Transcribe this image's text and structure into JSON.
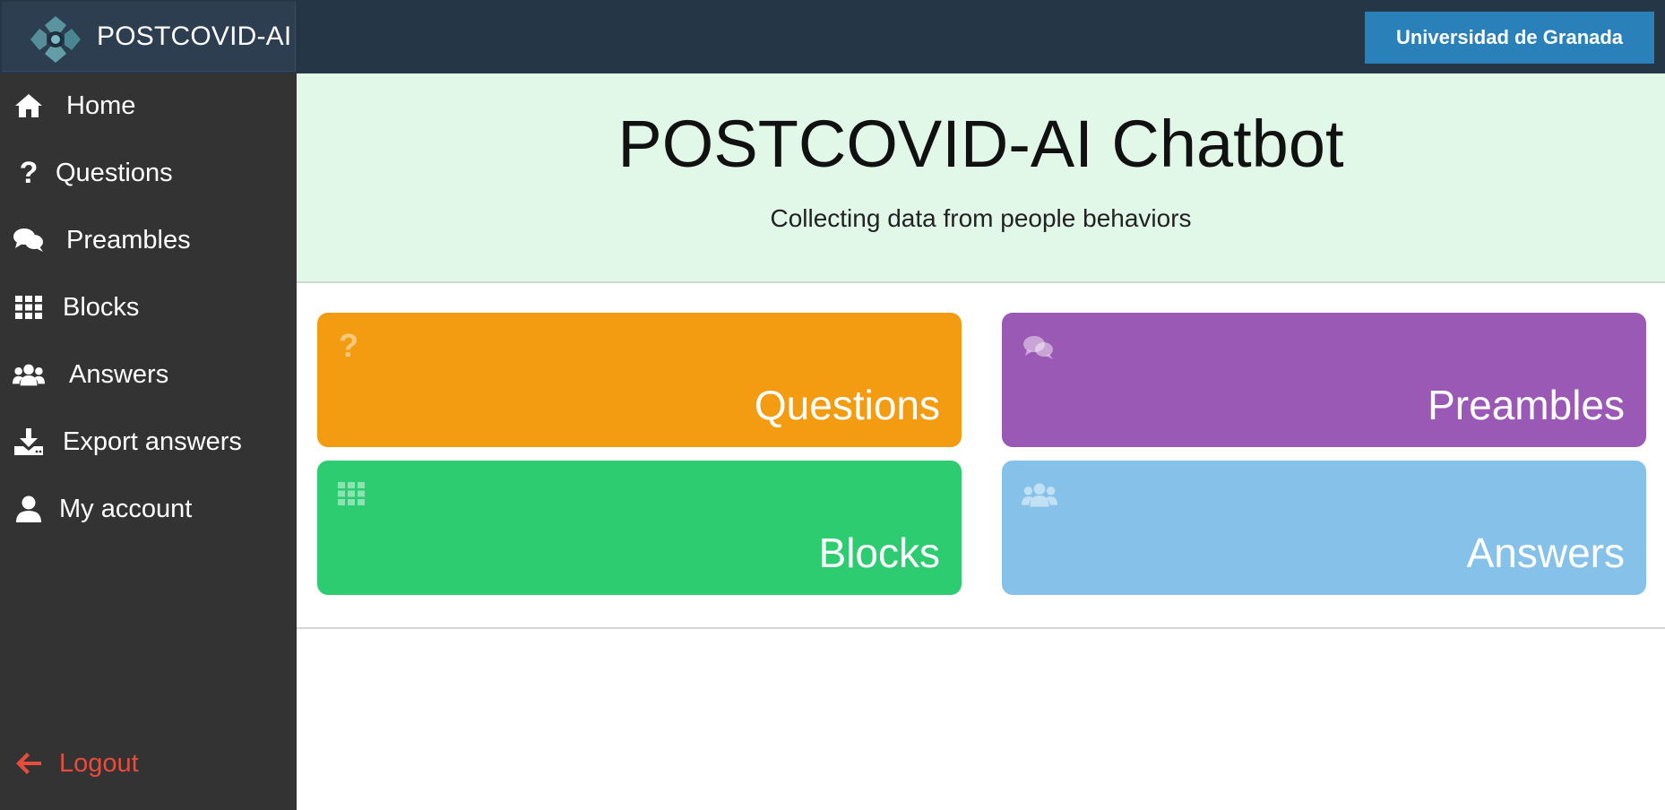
{
  "app": {
    "brand_name": "POSTCOVID-AI",
    "university_button": "Universidad de Granada"
  },
  "sidebar": {
    "items": [
      {
        "label": "Home",
        "icon": "home-icon"
      },
      {
        "label": "Questions",
        "icon": "question-icon"
      },
      {
        "label": "Preambles",
        "icon": "comments-icon"
      },
      {
        "label": "Blocks",
        "icon": "grid-icon"
      },
      {
        "label": "Answers",
        "icon": "users-icon"
      },
      {
        "label": "Export answers",
        "icon": "download-icon"
      },
      {
        "label": "My account",
        "icon": "user-icon"
      }
    ],
    "logout_label": "Logout"
  },
  "hero": {
    "title": "POSTCOVID-AI Chatbot",
    "subtitle": "Collecting data from people behaviors"
  },
  "tiles": [
    {
      "label": "Questions",
      "color": "#f39c12",
      "icon": "question-icon"
    },
    {
      "label": "Preambles",
      "color": "#9b59b6",
      "icon": "comments-icon"
    },
    {
      "label": "Blocks",
      "color": "#2ecc71",
      "icon": "grid-icon"
    },
    {
      "label": "Answers",
      "color": "#85c1e9",
      "icon": "users-icon"
    }
  ],
  "colors": {
    "topbar": "#253747",
    "sidebar": "#333333",
    "hero_bg": "#e1f8e9",
    "accent_button": "#2a80b9",
    "logout": "#e74c3c"
  }
}
